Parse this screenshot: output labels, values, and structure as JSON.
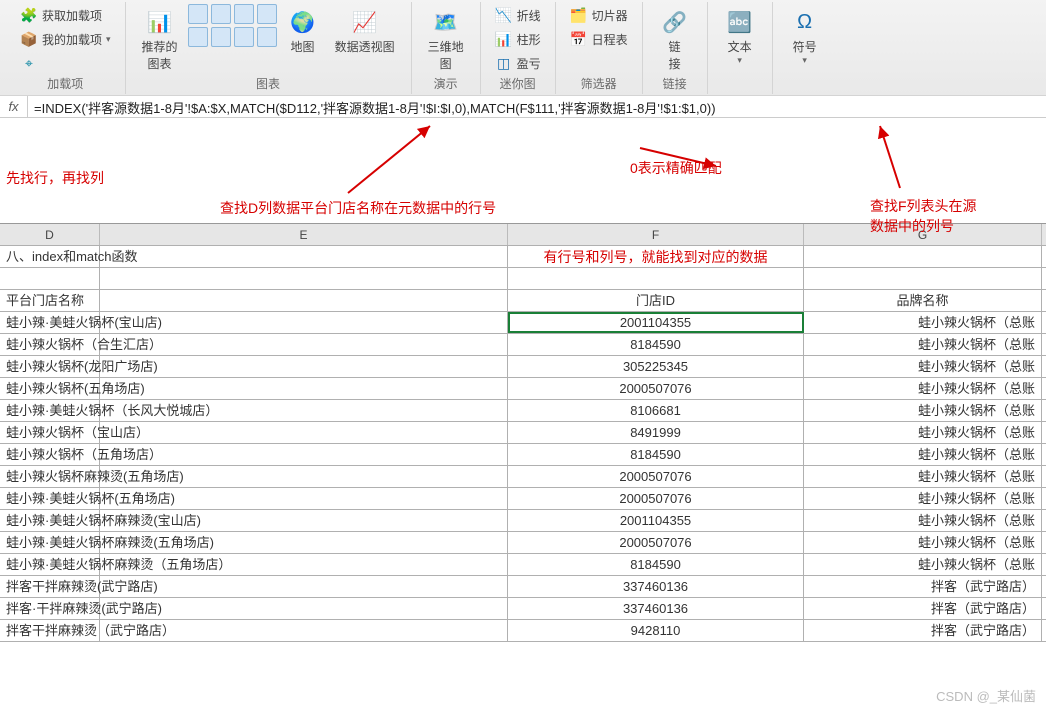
{
  "ribbon": {
    "addins": {
      "get": "获取加载项",
      "my": "我的加载项",
      "label": "加载项"
    },
    "charts": {
      "recommended": "推荐的\n图表",
      "map": "地图",
      "pivot": "数据透视图",
      "label": "图表"
    },
    "d3map": {
      "btn": "三维地\n图",
      "label": "演示"
    },
    "spark": {
      "line": "折线",
      "column": "柱形",
      "winloss": "盈亏",
      "label": "迷你图"
    },
    "filter": {
      "slicer": "切片器",
      "timeline": "日程表",
      "label": "筛选器"
    },
    "link": {
      "btn": "链\n接",
      "label": "链接"
    },
    "text": {
      "btn": "文本",
      "label": ""
    },
    "symbol": {
      "btn": "符号",
      "label": ""
    }
  },
  "formula": "=INDEX('拌客源数据1-8月'!$A:$X,MATCH($D112,'拌客源数据1-8月'!$I:$I,0),MATCH(F$111,'拌客源数据1-8月'!$1:$1,0))",
  "annotations": {
    "a1": "先找行，再找列",
    "a2": "查找D列数据平台门店名称在元数据中的行号",
    "a3": "0表示精确匹配",
    "a4": "查找F列表头在源\n数据中的列号",
    "a5": "有行号和列号，就能找到对应的数据"
  },
  "columns": {
    "d": "D",
    "e": "E",
    "f": "F",
    "g": "G"
  },
  "title_row": "八、index和match函数",
  "header_row": {
    "e": "平台门店名称",
    "f": "门店ID",
    "g": "品牌名称"
  },
  "rows": [
    {
      "e": "蛙小辣·美蛙火锅杯(宝山店)",
      "f": "2001104355",
      "g": "蛙小辣火锅杯（总账"
    },
    {
      "e": "蛙小辣火锅杯（合生汇店）",
      "f": "8184590",
      "g": "蛙小辣火锅杯（总账"
    },
    {
      "e": "蛙小辣火锅杯(龙阳广场店)",
      "f": "305225345",
      "g": "蛙小辣火锅杯（总账"
    },
    {
      "e": "蛙小辣火锅杯(五角场店)",
      "f": "2000507076",
      "g": "蛙小辣火锅杯（总账"
    },
    {
      "e": "蛙小辣·美蛙火锅杯（长风大悦城店）",
      "f": "8106681",
      "g": "蛙小辣火锅杯（总账"
    },
    {
      "e": "蛙小辣火锅杯（宝山店）",
      "f": "8491999",
      "g": "蛙小辣火锅杯（总账"
    },
    {
      "e": "蛙小辣火锅杯（五角场店）",
      "f": "8184590",
      "g": "蛙小辣火锅杯（总账"
    },
    {
      "e": "蛙小辣火锅杯麻辣烫(五角场店)",
      "f": "2000507076",
      "g": "蛙小辣火锅杯（总账"
    },
    {
      "e": "蛙小辣·美蛙火锅杯(五角场店)",
      "f": "2000507076",
      "g": "蛙小辣火锅杯（总账"
    },
    {
      "e": "蛙小辣·美蛙火锅杯麻辣烫(宝山店)",
      "f": "2001104355",
      "g": "蛙小辣火锅杯（总账"
    },
    {
      "e": "蛙小辣·美蛙火锅杯麻辣烫(五角场店)",
      "f": "2000507076",
      "g": "蛙小辣火锅杯（总账"
    },
    {
      "e": "蛙小辣·美蛙火锅杯麻辣烫（五角场店）",
      "f": "8184590",
      "g": "蛙小辣火锅杯（总账"
    },
    {
      "e": "拌客干拌麻辣烫(武宁路店)",
      "f": "337460136",
      "g": "拌客（武宁路店）"
    },
    {
      "e": "拌客·干拌麻辣烫(武宁路店)",
      "f": "337460136",
      "g": "拌客（武宁路店）"
    },
    {
      "e": "拌客干拌麻辣烫（武宁路店）",
      "f": "9428110",
      "g": "拌客（武宁路店）"
    }
  ],
  "watermark": "CSDN @_某仙菌"
}
